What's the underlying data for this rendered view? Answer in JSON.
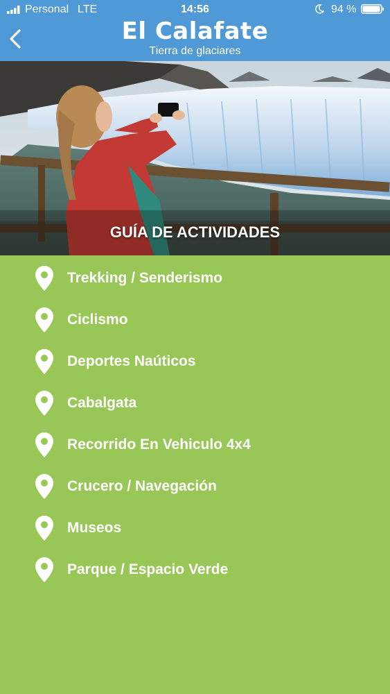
{
  "status_bar": {
    "carrier": "Personal",
    "network": "LTE",
    "time": "14:56",
    "battery_percent": "94 %"
  },
  "nav": {
    "title": "El Calafate",
    "subtitle": "Tierra de glaciares",
    "back_icon": "chevron-left-icon"
  },
  "hero": {
    "title": "GUÍA DE ACTIVIDADES"
  },
  "activities": [
    {
      "label": "Trekking / Senderismo",
      "icon": "location-pin-icon"
    },
    {
      "label": "Ciclismo",
      "icon": "location-pin-icon"
    },
    {
      "label": "Deportes Naúticos",
      "icon": "location-pin-icon"
    },
    {
      "label": "Cabalgata",
      "icon": "location-pin-icon"
    },
    {
      "label": "Recorrido En Vehiculo 4x4",
      "icon": "location-pin-icon"
    },
    {
      "label": "Crucero / Navegación",
      "icon": "location-pin-icon"
    },
    {
      "label": "Museos",
      "icon": "location-pin-icon"
    },
    {
      "label": "Parque / Espacio Verde",
      "icon": "location-pin-icon"
    }
  ],
  "colors": {
    "header_blue": "#4e99d6",
    "list_green": "#99c757",
    "text": "#ffffff"
  }
}
